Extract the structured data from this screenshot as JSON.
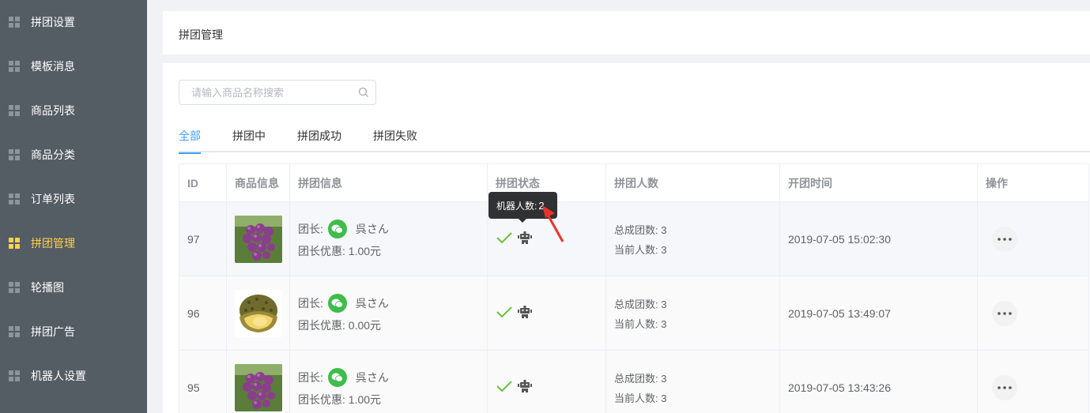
{
  "sidebar": {
    "items": [
      {
        "label": "拼团设置",
        "active": false
      },
      {
        "label": "模板消息",
        "active": false
      },
      {
        "label": "商品列表",
        "active": false
      },
      {
        "label": "商品分类",
        "active": false
      },
      {
        "label": "订单列表",
        "active": false
      },
      {
        "label": "拼团管理",
        "active": true
      },
      {
        "label": "轮播图",
        "active": false
      },
      {
        "label": "拼团广告",
        "active": false
      },
      {
        "label": "机器人设置",
        "active": false
      }
    ],
    "active_color": "#ffd04b",
    "background": "#545c64"
  },
  "header": {
    "title": "拼团管理"
  },
  "search": {
    "placeholder": "请输入商品名称搜索",
    "value": ""
  },
  "tabs": [
    {
      "label": "全部",
      "active": true
    },
    {
      "label": "拼团中",
      "active": false
    },
    {
      "label": "拼团成功",
      "active": false
    },
    {
      "label": "拼团失败",
      "active": false
    }
  ],
  "table": {
    "columns": [
      "ID",
      "商品信息",
      "拼团信息",
      "拼团状态",
      "拼团人数",
      "开团时间",
      "操作"
    ],
    "rows": [
      {
        "id": "97",
        "image": "grapes",
        "leader_label": "团长:",
        "leader_name": "呉さん",
        "discount": "团长优惠: 1.00元",
        "total_groups": "总成团数:  3",
        "current_people": "当前人数:  3",
        "time": "2019-07-05 15:02:30"
      },
      {
        "id": "96",
        "image": "durian",
        "leader_label": "团长:",
        "leader_name": "呉さん",
        "discount": "团长优惠: 0.00元",
        "total_groups": "总成团数:  3",
        "current_people": "当前人数:  3",
        "time": "2019-07-05 13:49:07"
      },
      {
        "id": "95",
        "image": "grapes",
        "leader_label": "团长:",
        "leader_name": "呉さん",
        "discount": "团长优惠: 1.00元",
        "total_groups": "总成团数:  3",
        "current_people": "当前人数:  3",
        "time": "2019-07-05 13:43:26"
      }
    ]
  },
  "tooltip": {
    "label": "机器人数:",
    "value": "2"
  },
  "colors": {
    "accent": "#409eff",
    "success": "#67c23a",
    "wechat": "#3dbd4a",
    "arrow": "#e8332a"
  }
}
